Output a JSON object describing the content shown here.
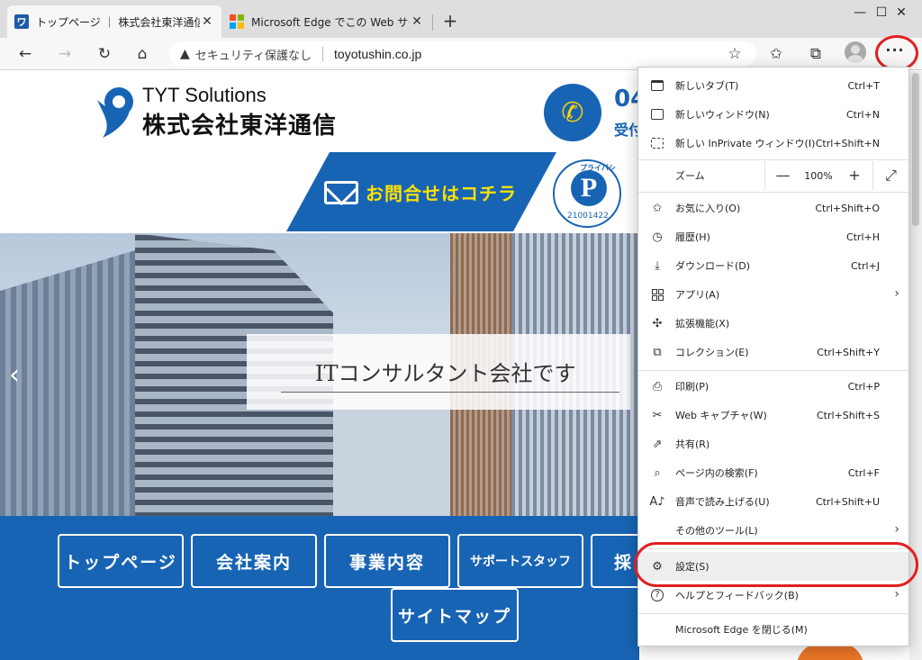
{
  "tabs": [
    {
      "title": "トップページ ｜ 株式会社東洋通信",
      "favicon": "tyt-logo-icon",
      "favicon_text": "ワ"
    },
    {
      "title": "Microsoft Edge でこの Web サイトを",
      "favicon": "microsoft-logo-icon"
    }
  ],
  "window_controls": {
    "minimize": "—",
    "maximize": "☐",
    "close": "✕"
  },
  "toolbar": {
    "back": "←",
    "forward": "→",
    "refresh": "↻",
    "home": "⌂",
    "security_icon": "▲",
    "security_text": "セキュリティ保護なし",
    "url": "toyotushin.co.jp",
    "add_favorite": "☆",
    "favorites": "✩",
    "collections": "⧉",
    "menu": "···"
  },
  "page": {
    "logo_en": "TYT Solutions",
    "logo_jp": "株式会社東洋通信",
    "phone_icon": "✆",
    "phone_number_partial": "04",
    "phone_sub_partial": "受付",
    "contact_button": "お問合せはコチラ",
    "privacy_mark": {
      "letter": "P",
      "label": "プライバシー",
      "number": "21001422"
    },
    "hero_text": "ITコンサルタント会社です",
    "hero_prev": "‹",
    "nav_buttons": [
      "トップページ",
      "会社案内",
      "事業内容",
      "サポートスタッフ",
      "採",
      "サイトマップ"
    ]
  },
  "menu": {
    "items_top": [
      {
        "label": "新しいタブ(T)",
        "shortcut": "Ctrl+T",
        "icon": "new-tab-icon"
      },
      {
        "label": "新しいウィンドウ(N)",
        "shortcut": "Ctrl+N",
        "icon": "new-window-icon"
      },
      {
        "label": "新しい InPrivate ウィンドウ(I)",
        "shortcut": "Ctrl+Shift+N",
        "icon": "inprivate-icon"
      }
    ],
    "zoom": {
      "label": "ズーム",
      "minus": "—",
      "value": "100%",
      "plus": "+",
      "fullscreen": "⤢"
    },
    "items_mid": [
      {
        "label": "お気に入り(O)",
        "shortcut": "Ctrl+Shift+O",
        "icon": "favorites-icon"
      },
      {
        "label": "履歴(H)",
        "shortcut": "Ctrl+H",
        "icon": "history-icon"
      },
      {
        "label": "ダウンロード(D)",
        "shortcut": "Ctrl+J",
        "icon": "download-icon"
      },
      {
        "label": "アプリ(A)",
        "shortcut": "",
        "icon": "apps-icon",
        "submenu": true
      },
      {
        "label": "拡張機能(X)",
        "shortcut": "",
        "icon": "extensions-icon"
      },
      {
        "label": "コレクション(E)",
        "shortcut": "Ctrl+Shift+Y",
        "icon": "collections-icon"
      }
    ],
    "items_tools": [
      {
        "label": "印刷(P)",
        "shortcut": "Ctrl+P",
        "icon": "print-icon"
      },
      {
        "label": "Web キャプチャ(W)",
        "shortcut": "Ctrl+Shift+S",
        "icon": "web-capture-icon"
      },
      {
        "label": "共有(R)",
        "shortcut": "",
        "icon": "share-icon"
      },
      {
        "label": "ページ内の検索(F)",
        "shortcut": "Ctrl+F",
        "icon": "find-icon"
      },
      {
        "label": "音声で読み上げる(U)",
        "shortcut": "Ctrl+Shift+U",
        "icon": "read-aloud-icon"
      },
      {
        "label": "その他のツール(L)",
        "shortcut": "",
        "icon": "",
        "submenu": true
      }
    ],
    "items_bottom": [
      {
        "label": "設定(S)",
        "shortcut": "",
        "icon": "settings-icon"
      },
      {
        "label": "ヘルプとフィードバック(B)",
        "shortcut": "",
        "icon": "help-icon",
        "submenu": true
      }
    ],
    "close": "Microsoft Edge を閉じる(M)",
    "arrow": "›"
  },
  "colors": {
    "brand_blue": "#1864b4",
    "accent_yellow": "#ffe100",
    "annotation_red": "#e02020"
  }
}
